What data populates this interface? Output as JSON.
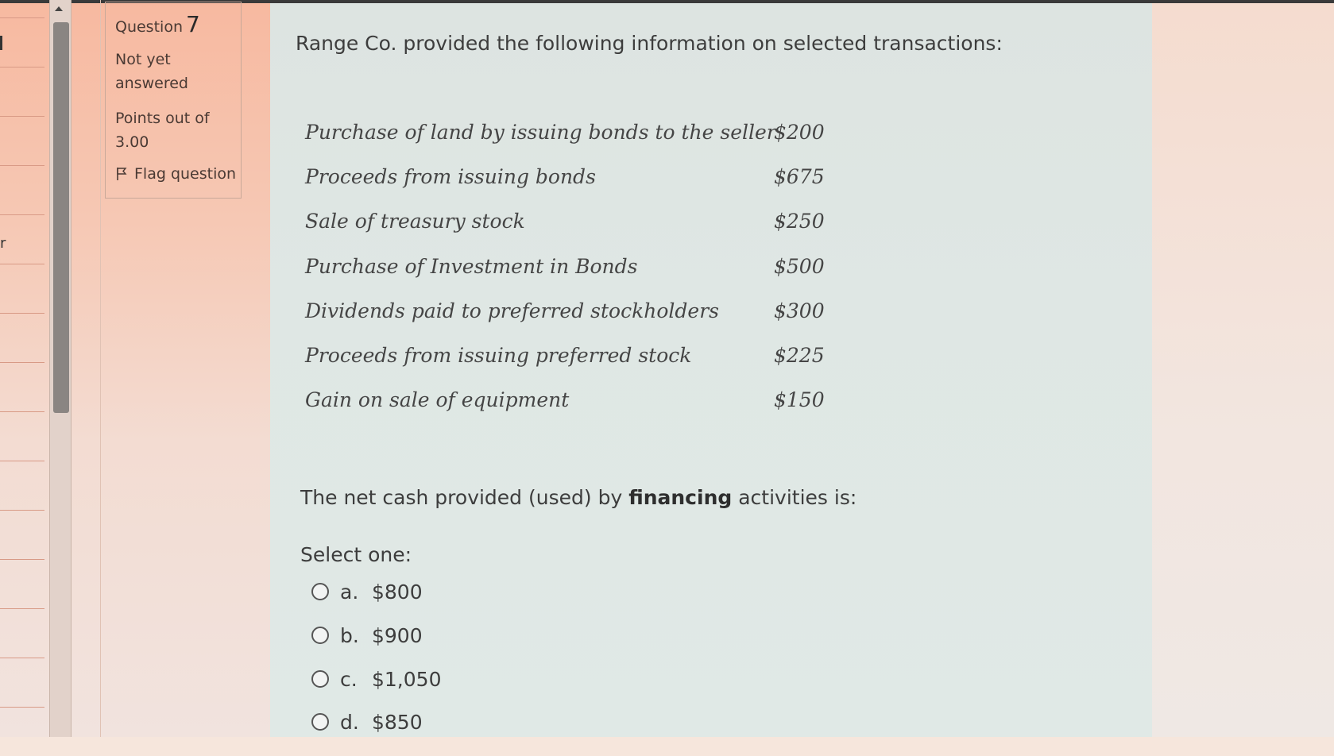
{
  "nav": {
    "letter": "r"
  },
  "question_info": {
    "label": "Question",
    "number": "7",
    "state": "Not yet answered",
    "grade": "Points out of 3.00",
    "flag_label": "Flag question"
  },
  "question": {
    "intro": "Range Co. provided the following information on selected transactions:",
    "transactions": [
      {
        "label": "Purchase of land by issuing bonds to the seller",
        "amount": "$200"
      },
      {
        "label": "Proceeds from issuing bonds",
        "amount": "$675"
      },
      {
        "label": "Sale of treasury stock",
        "amount": "$250"
      },
      {
        "label": "Purchase of Investment in Bonds",
        "amount": "$500"
      },
      {
        "label": "Dividends paid to preferred stockholders",
        "amount": "$300"
      },
      {
        "label": "Proceeds from issuing preferred stock",
        "amount": "$225"
      },
      {
        "label": "Gain on sale of equipment",
        "amount": "$150"
      }
    ],
    "prompt_before": "The net cash provided (used) by ",
    "prompt_bold": "financing",
    "prompt_after": " activities is:",
    "select_label": "Select one:",
    "options": [
      {
        "letter": "a.",
        "value": "$800"
      },
      {
        "letter": "b.",
        "value": "$900"
      },
      {
        "letter": "c.",
        "value": "$1,050"
      },
      {
        "letter": "d.",
        "value": "$850"
      }
    ]
  },
  "icons": {
    "flag": "flag-icon",
    "radio": "radio-button",
    "scroll_up": "chevron-up-icon"
  },
  "colors": {
    "content_bg": "#dfe7e4",
    "side_bg": "#f6c8b4",
    "text": "#3d3d3d"
  }
}
